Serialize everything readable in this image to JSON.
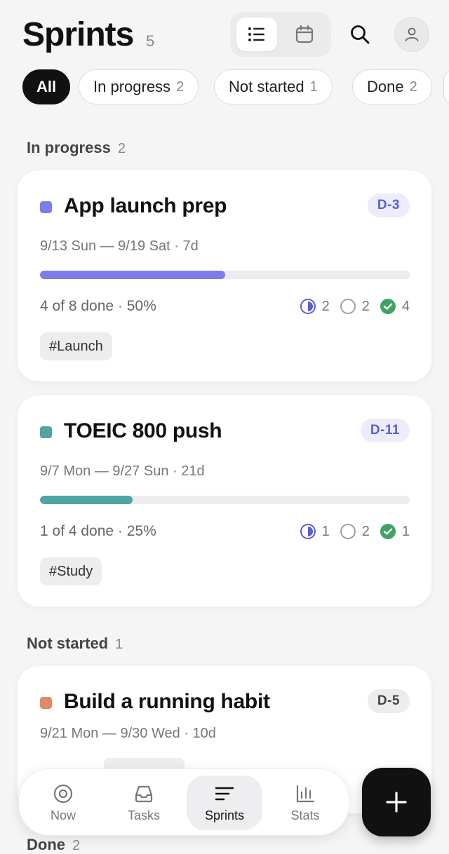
{
  "header": {
    "title": "Sprints",
    "count": "5"
  },
  "filters": [
    {
      "label": "All",
      "count": ""
    },
    {
      "label": "In progress",
      "count": "2"
    },
    {
      "label": "Not started",
      "count": "1"
    },
    {
      "label": "Done",
      "count": "2"
    }
  ],
  "sections": {
    "in_progress": {
      "label": "In progress",
      "count": "2"
    },
    "not_started": {
      "label": "Not started",
      "count": "1"
    },
    "done": {
      "label": "Done",
      "count": "2"
    }
  },
  "sprints": [
    {
      "name": "App launch prep",
      "color": "#7b7ee8",
      "dday": "D-3",
      "dates": "9/13 Sun — 9/19 Sat · 7d",
      "progress": 0.5,
      "done_text": "4 of 8 done · 50%",
      "in_progress": "2",
      "todo": "2",
      "completed": "4",
      "tag": "#Launch"
    },
    {
      "name": "TOEIC 800 push",
      "color": "#4fa4a5",
      "dday": "D-11",
      "dates": "9/7 Mon — 9/27 Sun · 21d",
      "progress": 0.25,
      "done_text": "1 of 4 done · 25%",
      "in_progress": "1",
      "todo": "2",
      "completed": "1",
      "tag": "#Study"
    },
    {
      "name": "Build a running habit",
      "color": "#e08a68",
      "dday": "D-5",
      "dates": "9/21 Mon — 9/30 Wed · 10d"
    }
  ],
  "colors": {
    "accent_dday_bg": "#ececfb",
    "accent_dday_text": "#5a5ed6",
    "neutral_dday_bg": "#ececee",
    "neutral_dday_text": "#444444",
    "check_green": "#3ea463",
    "half_circle": "#5a5ed6"
  },
  "nav": {
    "items": [
      {
        "label": "Now",
        "icon": "target-icon"
      },
      {
        "label": "Tasks",
        "icon": "inbox-icon"
      },
      {
        "label": "Sprints",
        "icon": "lines-icon"
      },
      {
        "label": "Stats",
        "icon": "bar-chart-icon"
      }
    ],
    "active": "Sprints"
  }
}
